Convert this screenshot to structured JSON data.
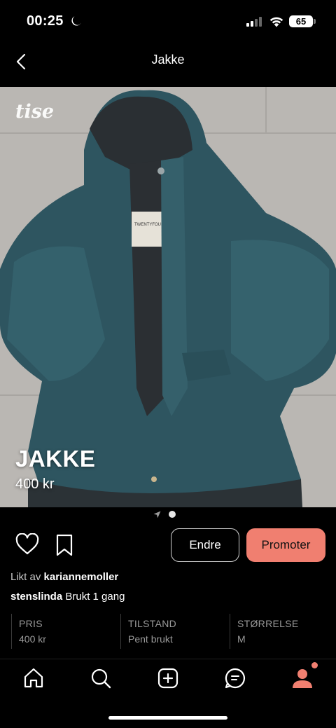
{
  "status_bar": {
    "time": "00:25",
    "battery": "65",
    "icons": [
      "moon-icon",
      "signal-icon",
      "wifi-icon",
      "battery-icon"
    ]
  },
  "header": {
    "title": "Jakke",
    "back_icon": "chevron-left-icon"
  },
  "listing": {
    "watermark": "tise",
    "title": "JAKKE",
    "price": "400 kr",
    "photo_label": "TWENTYFOUR"
  },
  "pager": {
    "count": 1,
    "active": 1
  },
  "actions": {
    "edit_label": "Endre",
    "promote_label": "Promoter",
    "promote_color": "#f07f70"
  },
  "social": {
    "liked_prefix": "Likt av",
    "liked_user": "kariannemoller",
    "seller": "stenslinda",
    "description": "Brukt 1 gang"
  },
  "attributes": [
    {
      "label": "PRIS",
      "value": "400 kr"
    },
    {
      "label": "TILSTAND",
      "value": "Pent brukt"
    },
    {
      "label": "STØRRELSE",
      "value": "M"
    }
  ],
  "tab_bar": {
    "items": [
      "home-icon",
      "search-icon",
      "add-icon",
      "chat-icon",
      "profile-icon"
    ],
    "active_color": "#f07f70"
  }
}
